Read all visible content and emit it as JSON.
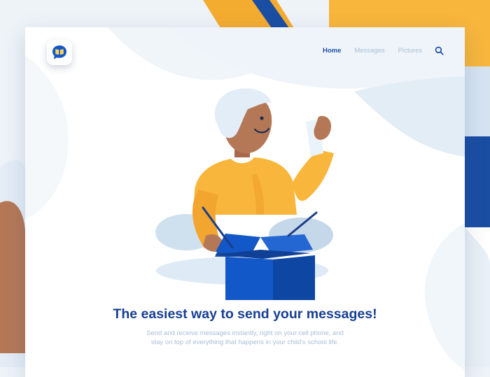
{
  "nav": {
    "home": "Home",
    "messages": "Messages",
    "pictures": "Pictures",
    "search_icon": "search-icon",
    "active": "home"
  },
  "logo": {
    "icon": "open-book-chat-bubble-icon"
  },
  "hero": {
    "title": "The easiest way to send your messages!",
    "subtitle": "Send and receive messages instantly, right on your cell phone, and stay on top of everything that happens in your child's school life."
  },
  "colors": {
    "brand_blue": "#163f93",
    "accent_yellow": "#f8b63c",
    "box_blue": "#1358c8",
    "muted_text": "#a7bfd8"
  }
}
